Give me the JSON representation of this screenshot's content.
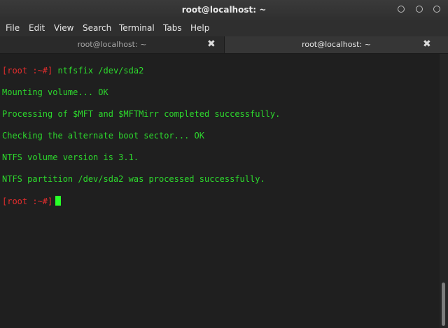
{
  "window": {
    "title": "root@localhost: ~"
  },
  "menu": {
    "items": [
      "File",
      "Edit",
      "View",
      "Search",
      "Terminal",
      "Tabs",
      "Help"
    ]
  },
  "tabs": [
    {
      "label": "root@localhost: ~",
      "active": false,
      "close": "✖"
    },
    {
      "label": "root@localhost: ~",
      "active": true,
      "close": "✖"
    }
  ],
  "terminal": {
    "prompt1": "[root :~#]",
    "command1": " ntfsfix /dev/sda2",
    "output": [
      "Mounting volume... OK",
      "Processing of $MFT and $MFTMirr completed successfully.",
      "Checking the alternate boot sector... OK",
      "NTFS volume version is 3.1.",
      "NTFS partition /dev/sda2 was processed successfully."
    ],
    "prompt2": "[root :~#]"
  },
  "colors": {
    "prompt": "#e52d2d",
    "text": "#2dd92d",
    "cursor": "#28ff28",
    "background": "#1f1f1f"
  }
}
